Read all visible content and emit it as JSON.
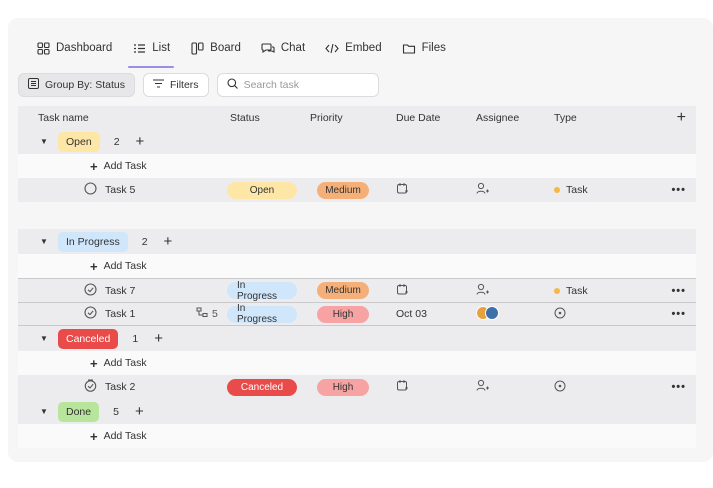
{
  "tabs": [
    {
      "label": "Dashboard",
      "icon": "grid-icon",
      "active": false
    },
    {
      "label": "List",
      "icon": "list-icon",
      "active": true
    },
    {
      "label": "Board",
      "icon": "board-icon",
      "active": false
    },
    {
      "label": "Chat",
      "icon": "chat-icon",
      "active": false
    },
    {
      "label": "Embed",
      "icon": "code-icon",
      "active": false
    },
    {
      "label": "Files",
      "icon": "folder-icon",
      "active": false
    }
  ],
  "toolbar": {
    "group_by_label": "Group By: Status",
    "filters_label": "Filters",
    "search_placeholder": "Search task"
  },
  "columns": {
    "task_name": "Task name",
    "status": "Status",
    "priority": "Priority",
    "due_date": "Due Date",
    "assignee": "Assignee",
    "type": "Type",
    "add": "+"
  },
  "add_task_label": "Add Task",
  "colors": {
    "open": "#fde6a6",
    "in_progress": "#cfe6fb",
    "canceled": "#e94a4a",
    "done": "#b7e59b",
    "medium": "#f5b07a",
    "high": "#f7a3a3",
    "task_dot": "#f5b746",
    "accent": "#9b8ee6"
  },
  "groups": {
    "open": {
      "label": "Open",
      "count": "2"
    },
    "in_progress": {
      "label": "In Progress",
      "count": "2"
    },
    "canceled": {
      "label": "Canceled",
      "count": "1"
    },
    "done": {
      "label": "Done",
      "count": "5"
    }
  },
  "tasks": {
    "task5": {
      "name": "Task 5",
      "status": "Open",
      "priority": "Medium",
      "type": "Task",
      "more": "•••"
    },
    "task7": {
      "name": "Task 7",
      "status": "In Progress",
      "priority": "Medium",
      "type": "Task",
      "more": "•••"
    },
    "task1": {
      "name": "Task 1",
      "subtasks": "5",
      "status": "In Progress",
      "priority": "High",
      "due": "Oct 03",
      "more": "•••"
    },
    "task2": {
      "name": "Task 2",
      "status": "Canceled",
      "priority": "High",
      "more": "•••"
    }
  }
}
